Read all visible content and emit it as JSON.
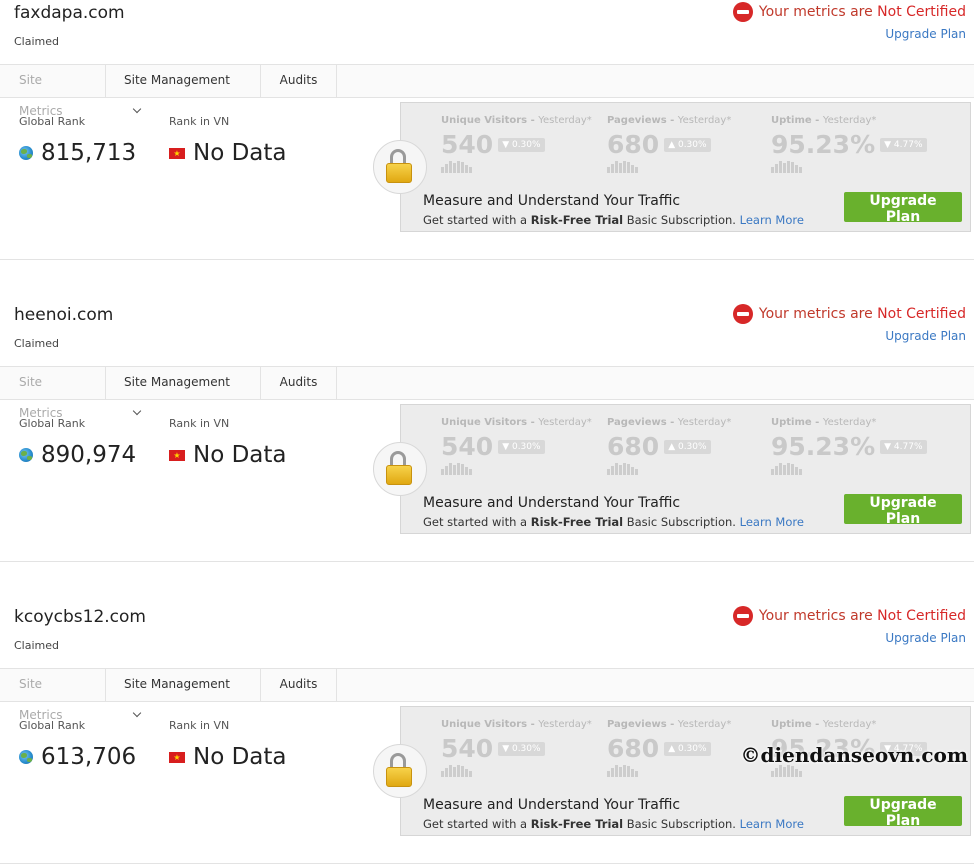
{
  "sites": [
    {
      "name": "faxdapa.com",
      "status": "Claimed",
      "cert_prefix": "Your metrics are",
      "cert_status": "Not Certified",
      "upgrade_link": "Upgrade Plan",
      "tabs": [
        "Site Metrics",
        "Site Management",
        "Audits"
      ],
      "global_rank_label": "Global Rank",
      "global_rank": "815,713",
      "country_rank_label": "Rank in VN",
      "country_rank": "No Data",
      "panel": {
        "metrics": [
          {
            "title": "Unique Visitors",
            "period": "Yesterday*",
            "value": "540",
            "change": "▼ 0.30%"
          },
          {
            "title": "Pageviews",
            "period": "Yesterday*",
            "value": "680",
            "change": "▲ 0.30%"
          },
          {
            "title": "Uptime",
            "period": "Yesterday*",
            "value": "95.23%",
            "change": "▼ 4.77%"
          }
        ],
        "headline": "Measure and Understand Your Traffic",
        "sub_pre": "Get started with a",
        "sub_bold": "Risk-Free Trial",
        "sub_post": "Basic Subscription.",
        "learn_more": "Learn More",
        "button": "Upgrade Plan"
      }
    },
    {
      "name": "heenoi.com",
      "status": "Claimed",
      "cert_prefix": "Your metrics are",
      "cert_status": "Not Certified",
      "upgrade_link": "Upgrade Plan",
      "tabs": [
        "Site Metrics",
        "Site Management",
        "Audits"
      ],
      "global_rank_label": "Global Rank",
      "global_rank": "890,974",
      "country_rank_label": "Rank in VN",
      "country_rank": "No Data",
      "panel": {
        "metrics": [
          {
            "title": "Unique Visitors",
            "period": "Yesterday*",
            "value": "540",
            "change": "▼ 0.30%"
          },
          {
            "title": "Pageviews",
            "period": "Yesterday*",
            "value": "680",
            "change": "▲ 0.30%"
          },
          {
            "title": "Uptime",
            "period": "Yesterday*",
            "value": "95.23%",
            "change": "▼ 4.77%"
          }
        ],
        "headline": "Measure and Understand Your Traffic",
        "sub_pre": "Get started with a",
        "sub_bold": "Risk-Free Trial",
        "sub_post": "Basic Subscription.",
        "learn_more": "Learn More",
        "button": "Upgrade Plan"
      }
    },
    {
      "name": "kcoycbs12.com",
      "status": "Claimed",
      "cert_prefix": "Your metrics are",
      "cert_status": "Not Certified",
      "upgrade_link": "Upgrade Plan",
      "tabs": [
        "Site Metrics",
        "Site Management",
        "Audits"
      ],
      "global_rank_label": "Global Rank",
      "global_rank": "613,706",
      "country_rank_label": "Rank in VN",
      "country_rank": "No Data",
      "panel": {
        "metrics": [
          {
            "title": "Unique Visitors",
            "period": "Yesterday*",
            "value": "540",
            "change": "▼ 0.30%"
          },
          {
            "title": "Pageviews",
            "period": "Yesterday*",
            "value": "680",
            "change": "▲ 0.30%"
          },
          {
            "title": "Uptime",
            "period": "Yesterday*",
            "value": "95.23%",
            "change": "▼ 4.77%"
          }
        ],
        "headline": "Measure and Understand Your Traffic",
        "sub_pre": "Get started with a",
        "sub_bold": "Risk-Free Trial",
        "sub_post": "Basic Subscription.",
        "learn_more": "Learn More",
        "button": "Upgrade Plan"
      }
    }
  ],
  "watermark": "©diendanseovn.com",
  "colors": {
    "accent_red": "#d72828",
    "link_blue": "#3a78c3",
    "button_green": "#69b12d"
  }
}
